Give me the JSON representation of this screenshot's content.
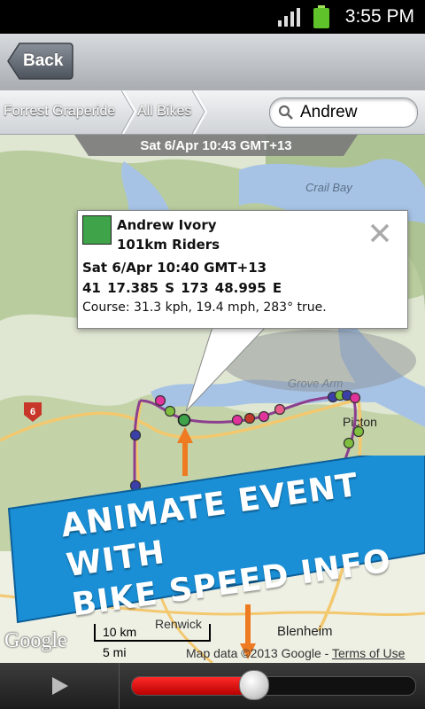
{
  "status_bar": {
    "time": "3:55 PM"
  },
  "nav": {
    "back_label": "Back"
  },
  "breadcrumb": {
    "items": [
      "Forrest Graperide",
      "All Bikes"
    ]
  },
  "search": {
    "value": "Andrew"
  },
  "map": {
    "timestamp": "Sat 6/Apr 10:43 GMT+13",
    "labels": {
      "crail_bay": "Crail Bay",
      "grove_arm": "Grove Arm",
      "picton": "Picton",
      "renwick": "Renwick",
      "blenheim": "Blenheim",
      "route_6": "6"
    },
    "scale": {
      "km": "10 km",
      "mi": "5 mi"
    },
    "google_logo": "Google",
    "attribution": "Map data ©2013 Google",
    "attribution_separator": " - ",
    "terms": "Terms of Use"
  },
  "popup": {
    "swatch_color": "#3fa34a",
    "name": "Andrew Ivory",
    "group": "101km Riders",
    "time": "Sat 6/Apr 10:40 GMT+13",
    "position": "41 17.385 S  173 48.995 E",
    "course": "Course:  31.3 kph,  19.4 mph,  283° true."
  },
  "banner": {
    "line1": "ANIMATE EVENT WITH",
    "line2": "BIKE SPEED INFO",
    "color": "#1a8fd6"
  },
  "playback": {
    "progress": 0.43
  },
  "colors": {
    "route": "#8c3f8f",
    "slider_fill": "#e01010",
    "arrow": "#ee7a22"
  }
}
